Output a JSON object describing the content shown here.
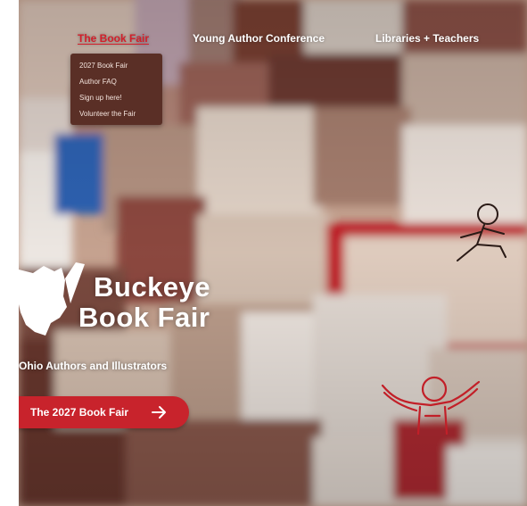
{
  "nav": {
    "items": [
      "The Book Fair",
      "Young Author Conference",
      "Libraries + Teachers"
    ],
    "active": "The Book Fair"
  },
  "dropdown": {
    "items": [
      "2027 Book Fair",
      "Author FAQ",
      "Sign up here!",
      "Volunteer the Fair"
    ]
  },
  "hero": {
    "brand_line1": "Buckeye",
    "brand_line2": "Book Fair",
    "tagline": "Ohio Authors and Illustrators",
    "cta_label": "The 2027 Book Fair"
  },
  "colors": {
    "accent": "#c8232c",
    "dropdown_bg": "#5a2f26",
    "text_light": "#ffffff"
  },
  "icons": [
    "ohio-map-logo-icon",
    "arrow-right-icon",
    "reading-figure-icon",
    "jumping-figure-icon"
  ]
}
